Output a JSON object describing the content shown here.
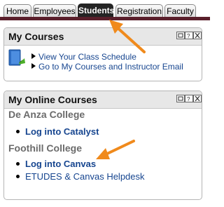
{
  "tabs": [
    {
      "label": "Home",
      "active": false
    },
    {
      "label": "Employees",
      "active": false
    },
    {
      "label": "Students",
      "active": true
    },
    {
      "label": "Registration",
      "active": false
    },
    {
      "label": "Faculty",
      "active": false
    }
  ],
  "my_courses": {
    "title": "My Courses",
    "links": [
      "View Your Class Schedule",
      "Go to My Courses and Instructor Email"
    ]
  },
  "online_courses": {
    "title": "My Online Courses",
    "deanza": {
      "heading": "De Anza College",
      "links": [
        "Log into Catalyst"
      ]
    },
    "foothill": {
      "heading": "Foothill College",
      "links": [
        "Log into Canvas",
        "ETUDES & Canvas Helpdesk"
      ]
    }
  },
  "colors": {
    "accent_tabline": "#5a1f2b",
    "annotation_arrow": "#f08a1c",
    "link": "#16458f"
  },
  "icons": [
    "book-icon",
    "portlet-edit-icon",
    "portlet-help-icon",
    "portlet-close-icon"
  ]
}
